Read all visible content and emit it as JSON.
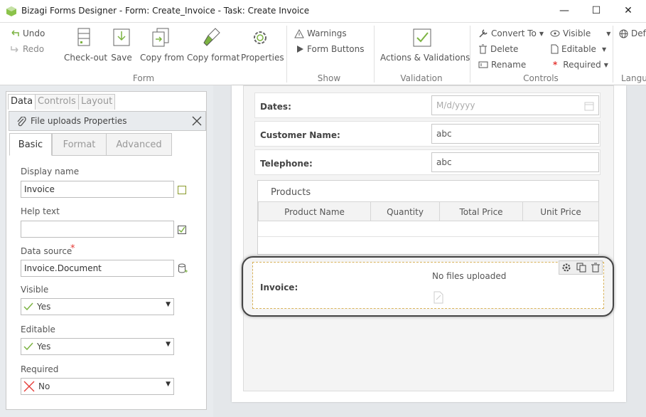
{
  "window": {
    "title": "Bizagi Forms Designer  - Form: Create_Invoice - Task:  Create Invoice",
    "minimize": "—",
    "maximize": "☐",
    "close": "✕"
  },
  "ribbon": {
    "undo": "Undo",
    "redo": "Redo",
    "checkout": "Check-out",
    "save": "Save",
    "copy_from": "Copy from",
    "copy_format": "Copy format",
    "properties": "Properties",
    "group_form": "Form",
    "warnings": "Warnings",
    "form_buttons": "Form Buttons",
    "group_show": "Show",
    "actions_validations": "Actions & Validations",
    "group_validation": "Validation",
    "convert_to": "Convert To",
    "delete": "Delete",
    "rename": "Rename",
    "visible": "Visible",
    "editable": "Editable",
    "required": "Required",
    "group_controls": "Controls",
    "group_language": "Langu",
    "default": "Def"
  },
  "left_tabs": [
    "Data",
    "Controls",
    "Layout"
  ],
  "properties_panel": {
    "title": "File uploads Properties",
    "tabs": [
      "Basic",
      "Format",
      "Advanced"
    ],
    "display_name_label": "Display name",
    "display_name_value": "Invoice",
    "help_text_label": "Help text",
    "help_text_value": "",
    "data_source_label": "Data source",
    "data_source_value": "Invoice.Document",
    "required_mark": "*",
    "visible_label": "Visible",
    "visible_value": "Yes",
    "editable_label": "Editable",
    "editable_value": "Yes",
    "required_label": "Required",
    "required_value": "No"
  },
  "form": {
    "dates_label": "Dates:",
    "dates_placeholder": "M/d/yyyy",
    "customer_label": "Customer Name:",
    "customer_value": "abc",
    "telephone_label": "Telephone:",
    "telephone_value": "abc",
    "products_title": "Products",
    "columns": [
      "Product Name",
      "Quantity",
      "Total Price",
      "Unit Price"
    ],
    "invoice_label": "Invoice:",
    "no_files": "No files uploaded"
  },
  "colors": {
    "accent_green": "#7cb342",
    "highlight_dashed": "#d8b25a",
    "required_red": "#e53935"
  }
}
